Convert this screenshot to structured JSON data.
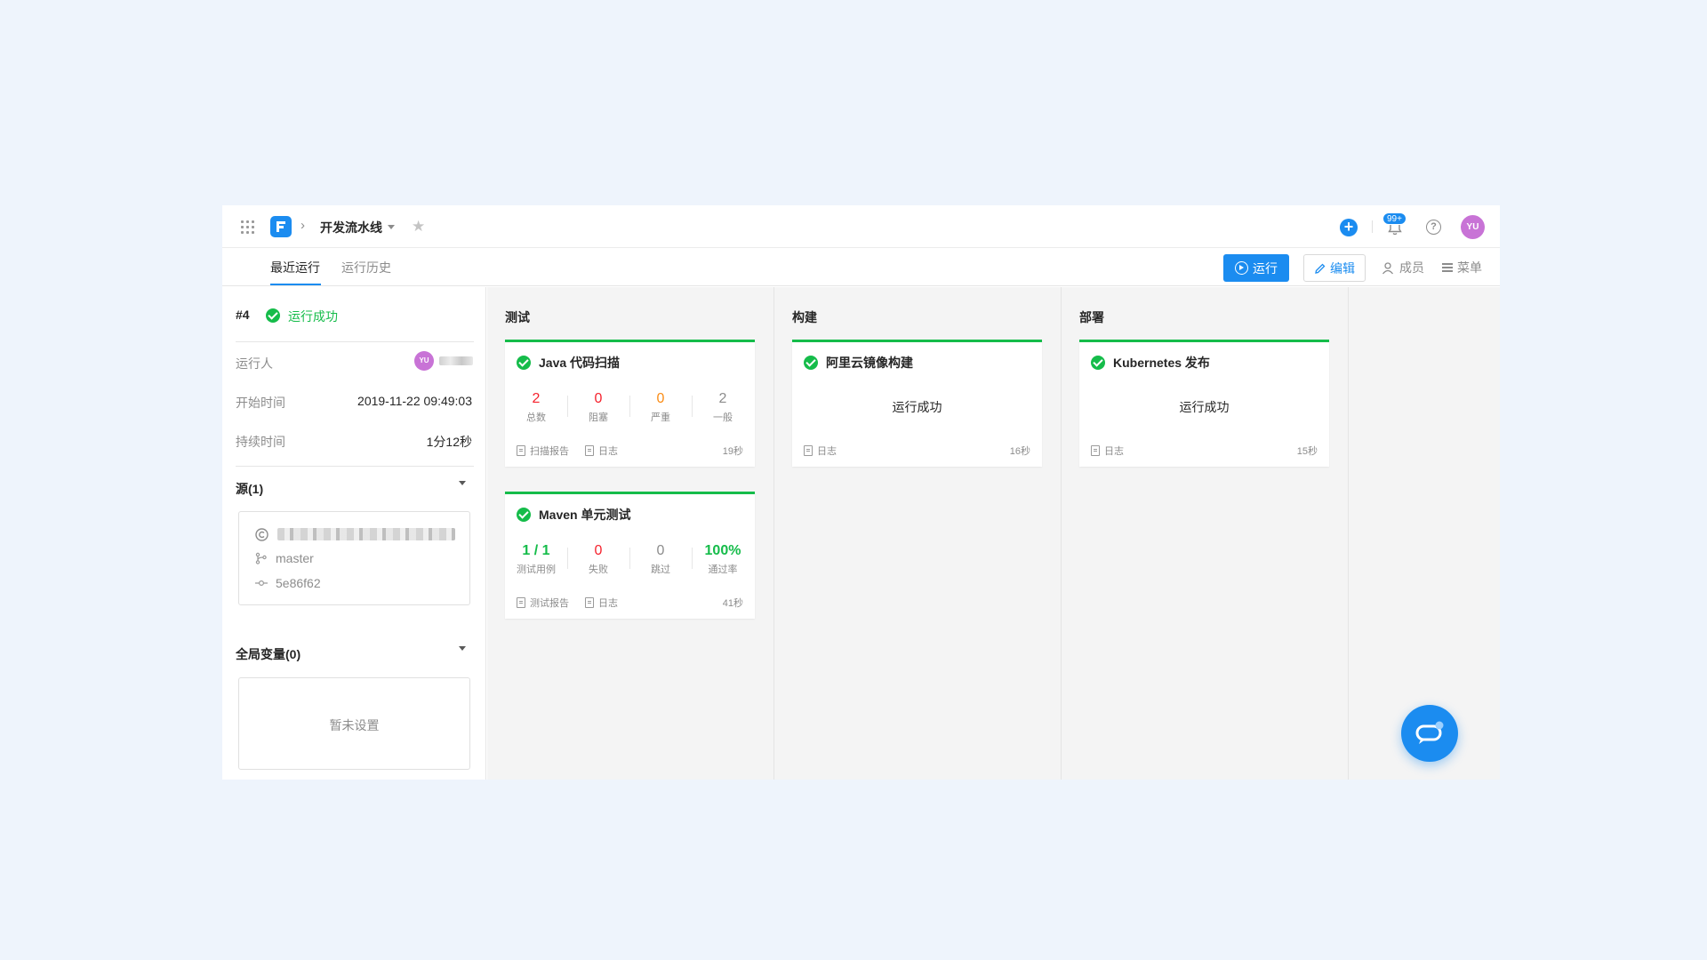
{
  "header": {
    "pipeline_name": "开发流水线",
    "notification_count": "99+",
    "avatar_initials": "YU"
  },
  "tabs": [
    {
      "label": "最近运行",
      "active": true
    },
    {
      "label": "运行历史",
      "active": false
    }
  ],
  "actions": {
    "run_label": "运行",
    "edit_label": "编辑",
    "members_label": "成员",
    "menu_label": "菜单"
  },
  "run": {
    "number": "#4",
    "status": "运行成功",
    "runner_label": "运行人",
    "runner_avatar": "YU",
    "start_label": "开始时间",
    "start_time": "2019-11-22 09:49:03",
    "duration_label": "持续时间",
    "duration": "1分12秒"
  },
  "source": {
    "title": "源(1)",
    "branch": "master",
    "commit": "5e86f62"
  },
  "variables": {
    "title": "全局变量(0)",
    "empty_text": "暂未设置"
  },
  "stages": [
    {
      "title": "测试",
      "jobs": [
        {
          "name": "Java 代码扫描",
          "metrics": [
            {
              "value": "2",
              "label": "总数",
              "color": "#f5222d"
            },
            {
              "value": "0",
              "label": "阻塞",
              "color": "#f5222d"
            },
            {
              "value": "0",
              "label": "严重",
              "color": "#fa8c16"
            },
            {
              "value": "2",
              "label": "一般",
              "color": "#8c8c8c"
            }
          ],
          "report_label": "扫描报告",
          "log_label": "日志",
          "duration": "19秒"
        },
        {
          "name": "Maven 单元测试",
          "metrics": [
            {
              "value": "1 / 1",
              "label": "测试用例",
              "color": "#15bc4a"
            },
            {
              "value": "0",
              "label": "失败",
              "color": "#f5222d"
            },
            {
              "value": "0",
              "label": "跳过",
              "color": "#8c8c8c"
            },
            {
              "value": "100%",
              "label": "通过率",
              "color": "#15bc4a"
            }
          ],
          "report_label": "测试报告",
          "log_label": "日志",
          "duration": "41秒"
        }
      ]
    },
    {
      "title": "构建",
      "jobs": [
        {
          "name": "阿里云镜像构建",
          "status": "运行成功",
          "log_label": "日志",
          "duration": "16秒"
        }
      ]
    },
    {
      "title": "部署",
      "jobs": [
        {
          "name": "Kubernetes 发布",
          "status": "运行成功",
          "log_label": "日志",
          "duration": "15秒"
        }
      ]
    }
  ],
  "colors": {
    "accent": "#1b8cf0",
    "success": "#15bc4a",
    "danger": "#f5222d",
    "warning": "#fa8c16",
    "avatar": "#c873d6"
  }
}
